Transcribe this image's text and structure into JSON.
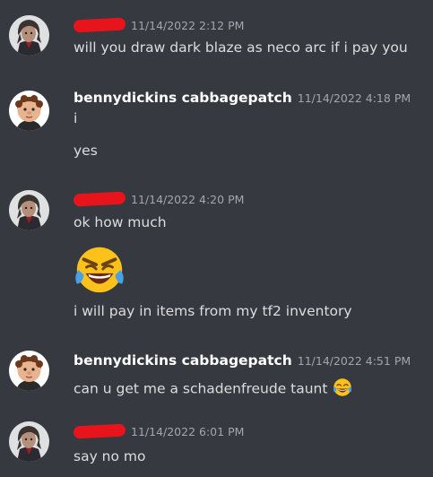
{
  "messages": [
    {
      "author": "",
      "author_redacted": true,
      "avatar": "anime-character-avatar",
      "timestamp": "11/14/2022 2:12 PM",
      "lines": [
        "will you draw dark blaze as neco arc if i pay you"
      ]
    },
    {
      "author": "bennydickins cabbagepatch",
      "author_redacted": false,
      "avatar": "cabbage-patch-doll-avatar",
      "timestamp": "11/14/2022 4:18 PM",
      "lines": [
        "i",
        "yes"
      ]
    },
    {
      "author": "",
      "author_redacted": true,
      "avatar": "anime-character-avatar",
      "timestamp": "11/14/2022 4:20 PM",
      "lines": [
        "ok how much",
        "i will pay in items from my tf2 inventory"
      ],
      "jumbo_emoji": "angry-laughing-crying-emoji"
    },
    {
      "author": "bennydickins cabbagepatch",
      "author_redacted": false,
      "avatar": "cabbage-patch-doll-avatar",
      "timestamp": "11/14/2022 4:51 PM",
      "lines": [
        "can u get me a schadenfreude taunt"
      ],
      "inline_emoji": "joy-emoji"
    },
    {
      "author": "",
      "author_redacted": true,
      "avatar": "anime-character-avatar",
      "timestamp": "11/14/2022 6:01 PM",
      "lines": [
        "say no mo"
      ]
    }
  ],
  "colors": {
    "background": "#36393f",
    "username": "#ffffff",
    "message_text": "#dcddde",
    "timestamp": "#a3a6aa",
    "redaction": "#e8141b"
  }
}
